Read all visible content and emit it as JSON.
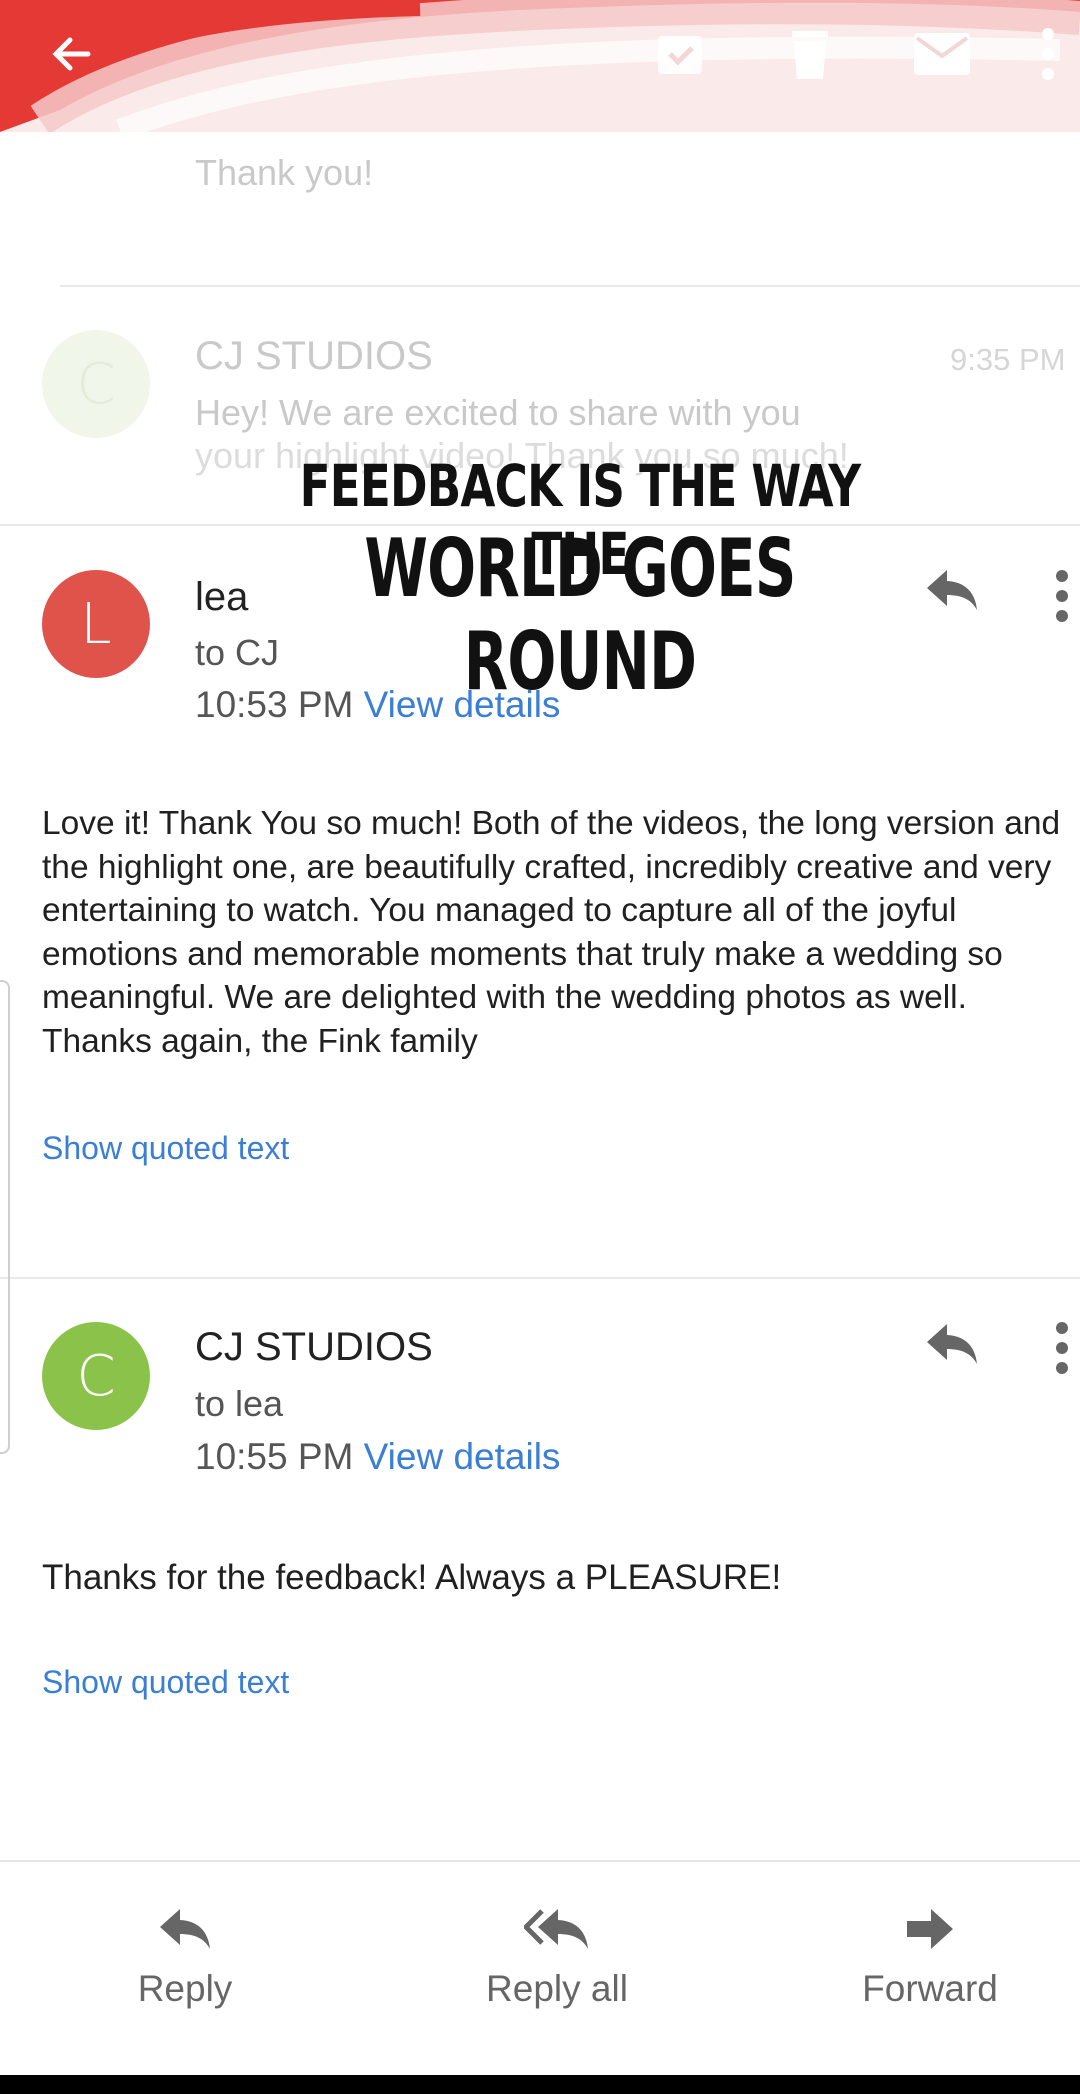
{
  "top_bar": {
    "icons": [
      "back-arrow-icon",
      "archive-icon",
      "trash-icon",
      "mail-icon",
      "more-icon"
    ],
    "scribble_color": "#e53935"
  },
  "faded_messages": [
    {
      "snippet": "Thank you!"
    },
    {
      "sender": "CJ STUDIOS",
      "time": "9:35 PM",
      "snippet_line1": "Hey! We are excited to share with you",
      "snippet_line2": "your highlight video! Thank you so much!"
    }
  ],
  "overlay": {
    "line1": "FEEDBACK IS THE WAY THE",
    "line2": "WORLD GOES ROUND"
  },
  "messages": [
    {
      "avatar_letter": "L",
      "avatar_color": "#e0534a",
      "sender": "lea",
      "to": "to CJ",
      "time": "10:53 PM",
      "details_link": "View details",
      "body": "Love it! Thank You so much! Both of the videos, the long version and the highlight one, are beautifully crafted, incredibly creative and very entertaining to watch. You managed to capture all of the joyful emotions and memorable moments that truly make a wedding so meaningful. We are delighted with the wedding photos as well. Thanks again, the Fink family",
      "quoted": "Show quoted text"
    },
    {
      "avatar_letter": "C",
      "avatar_color": "#8bc34a",
      "sender": "CJ STUDIOS",
      "to": "to lea",
      "time": "10:55 PM",
      "details_link": "View details",
      "body": "Thanks for the feedback! Always a PLEASURE!",
      "quoted": "Show quoted text"
    }
  ],
  "bottom_bar": {
    "reply": "Reply",
    "reply_all": "Reply all",
    "forward": "Forward"
  }
}
